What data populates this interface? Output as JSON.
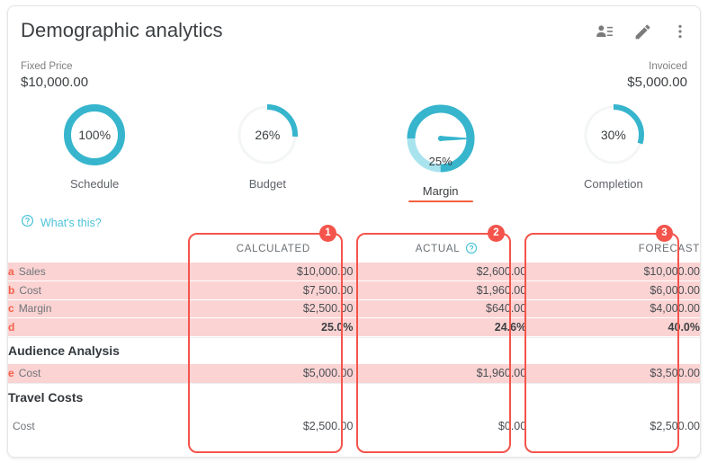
{
  "header": {
    "title": "Demographic analytics",
    "icons": [
      {
        "name": "contact-list-icon",
        "label": "Contacts"
      },
      {
        "name": "edit-pencil-icon",
        "label": "Edit"
      },
      {
        "name": "more-vert-icon",
        "label": "More options"
      }
    ]
  },
  "summary": {
    "fixed_price_label": "Fixed Price",
    "fixed_price_value": "$10,000.00",
    "invoiced_label": "Invoiced",
    "invoiced_value": "$5,000.00"
  },
  "gauges": [
    {
      "name": "Schedule",
      "percent_label": "100%",
      "percent": 100,
      "type": "ring",
      "selected": false
    },
    {
      "name": "Budget",
      "percent_label": "26%",
      "percent": 26,
      "type": "ring",
      "selected": false
    },
    {
      "name": "Margin",
      "percent_label": "25%",
      "percent": 25,
      "type": "gauge",
      "selected": true
    },
    {
      "name": "Completion",
      "percent_label": "30%",
      "percent": 30,
      "type": "ring",
      "selected": false
    }
  ],
  "help_link": {
    "icon": "help-circle-icon",
    "text": "What's this?"
  },
  "table": {
    "columns": [
      {
        "key": "calculated",
        "label": "CALCULATED",
        "badge": "1",
        "help": false
      },
      {
        "key": "actual",
        "label": "ACTUAL",
        "badge": "2",
        "help": true
      },
      {
        "key": "forecast",
        "label": "FORECAST",
        "badge": "3",
        "help": false
      }
    ],
    "rows": [
      {
        "key": "a",
        "label": "Sales",
        "calculated": "$10,000.00",
        "actual": "$2,600.00",
        "forecast": "$10,000.00",
        "highlight": true,
        "bold": false
      },
      {
        "key": "b",
        "label": "Cost",
        "calculated": "$7,500.00",
        "actual": "$1,960.00",
        "forecast": "$6,000.00",
        "highlight": true,
        "bold": false
      },
      {
        "key": "c",
        "label": "Margin",
        "calculated": "$2,500.00",
        "actual": "$640.00",
        "forecast": "$4,000.00",
        "highlight": true,
        "bold": false
      },
      {
        "key": "d",
        "label": "",
        "calculated": "25.0%",
        "actual": "24.6%",
        "forecast": "40.0%",
        "highlight": true,
        "bold": true
      }
    ],
    "sections": [
      {
        "title": "Audience Analysis",
        "rows": [
          {
            "key": "e",
            "label": "Cost",
            "calculated": "$5,000.00",
            "actual": "$1,960.00",
            "forecast": "$3,500.00",
            "highlight": true,
            "bold": false
          }
        ]
      },
      {
        "title": "Travel Costs",
        "rows": [
          {
            "key": "",
            "label": "Cost",
            "calculated": "$2,500.00",
            "actual": "$0.00",
            "forecast": "$2,500.00",
            "highlight": false,
            "bold": false
          }
        ]
      }
    ]
  },
  "colors": {
    "teal": "#36b5cd",
    "teal_light": "#a9e3ee",
    "track": "#f0f2f3",
    "red": "#f4544b",
    "pink_row": "#fbd3d3",
    "orange_underline": "#f4603e",
    "text_dark": "#3c4043",
    "text_muted": "#6b7075"
  }
}
